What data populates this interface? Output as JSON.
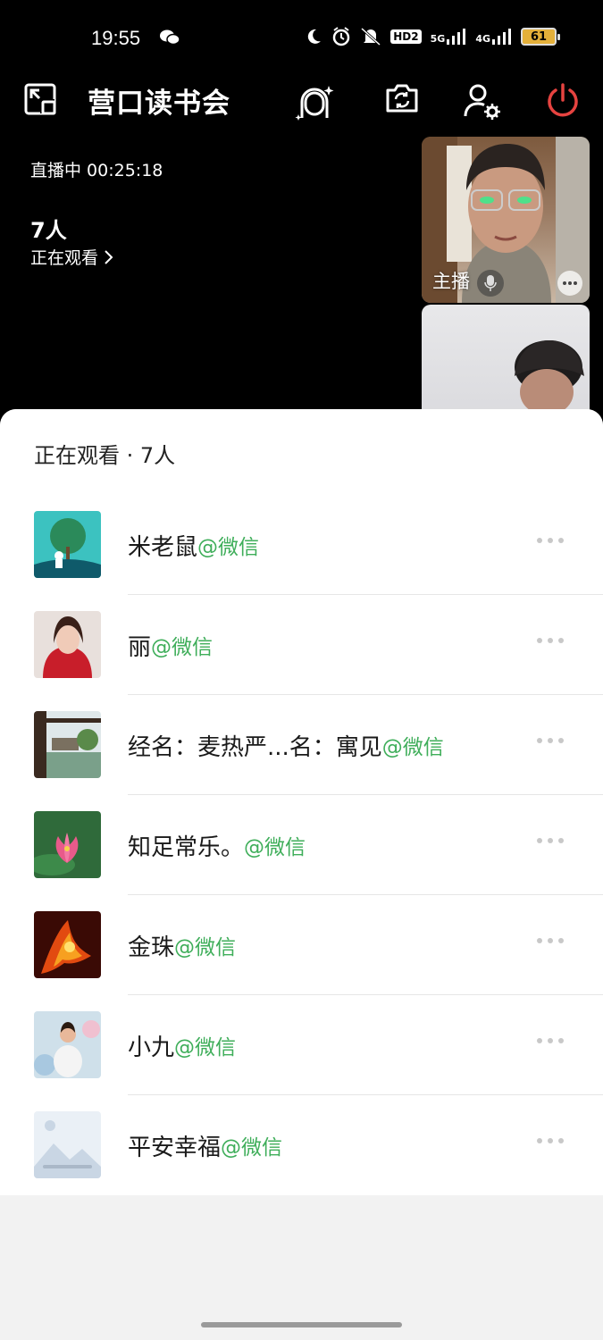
{
  "status_bar": {
    "time": "19:55",
    "battery": "61",
    "signal_labels": [
      "HD2",
      "5G",
      "4G"
    ]
  },
  "header": {
    "title": "营口读书会"
  },
  "live": {
    "status": "直播中 00:25:18",
    "viewer_count": "7人",
    "viewer_link": "正在观看"
  },
  "tiles": {
    "host_label": "主播"
  },
  "sheet": {
    "title": "正在观看 · 7人",
    "viewers": [
      {
        "name": "米老鼠",
        "tag": "@微信"
      },
      {
        "name": "丽",
        "tag": "@微信"
      },
      {
        "name": "经名：麦热严...名：寓见",
        "tag": "@微信"
      },
      {
        "name": "知足常乐。",
        "tag": "@微信"
      },
      {
        "name": "金珠",
        "tag": "@微信"
      },
      {
        "name": "小九",
        "tag": "@微信"
      },
      {
        "name": "平安幸福",
        "tag": "@微信"
      }
    ]
  },
  "colors": {
    "accent_green": "#3fae5a",
    "power_red": "#e64340"
  }
}
